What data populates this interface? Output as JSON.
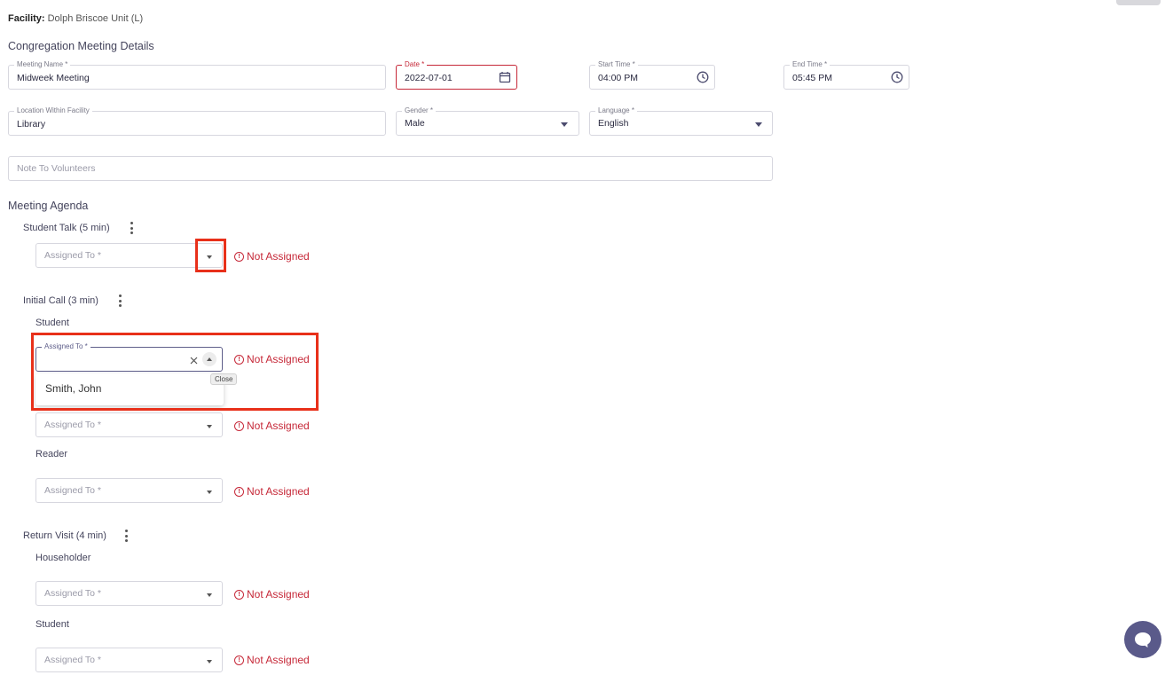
{
  "facility": {
    "label": "Facility:",
    "value": "Dolph Briscoe Unit (L)"
  },
  "details": {
    "title": "Congregation Meeting Details",
    "meeting_name": {
      "label": "Meeting Name *",
      "value": "Midweek Meeting"
    },
    "date": {
      "label": "Date *",
      "value": "2022-07-01"
    },
    "start_time": {
      "label": "Start Time *",
      "value": "04:00 PM"
    },
    "end_time": {
      "label": "End Time *",
      "value": "05:45 PM"
    },
    "location": {
      "label": "Location Within Facility",
      "value": "Library"
    },
    "gender": {
      "label": "Gender *",
      "value": "Male"
    },
    "language": {
      "label": "Language *",
      "value": "English"
    },
    "note": {
      "placeholder": "Note To Volunteers"
    }
  },
  "agenda": {
    "title": "Meeting Agenda",
    "assigned_placeholder": "Assigned To *",
    "not_assigned": "Not Assigned",
    "student_talk": {
      "title": "Student Talk (5 min)"
    },
    "initial_call": {
      "title": "Initial Call (3 min)",
      "student_label": "Student",
      "assigned_label": "Assigned To *",
      "dropdown_option": "Smith, John",
      "close_tooltip": "Close",
      "reader_label": "Reader"
    },
    "return_visit": {
      "title": "Return Visit (4 min)",
      "householder_label": "Householder",
      "student_label": "Student"
    }
  },
  "colors": {
    "error": "#c62838",
    "highlight": "#e8301a",
    "accent": "#5a5a8a"
  },
  "icons": [
    "calendar-icon",
    "clock-icon",
    "chevron-down-icon",
    "kebab-menu-icon",
    "alert-circle-icon",
    "close-icon",
    "chat-icon"
  ]
}
